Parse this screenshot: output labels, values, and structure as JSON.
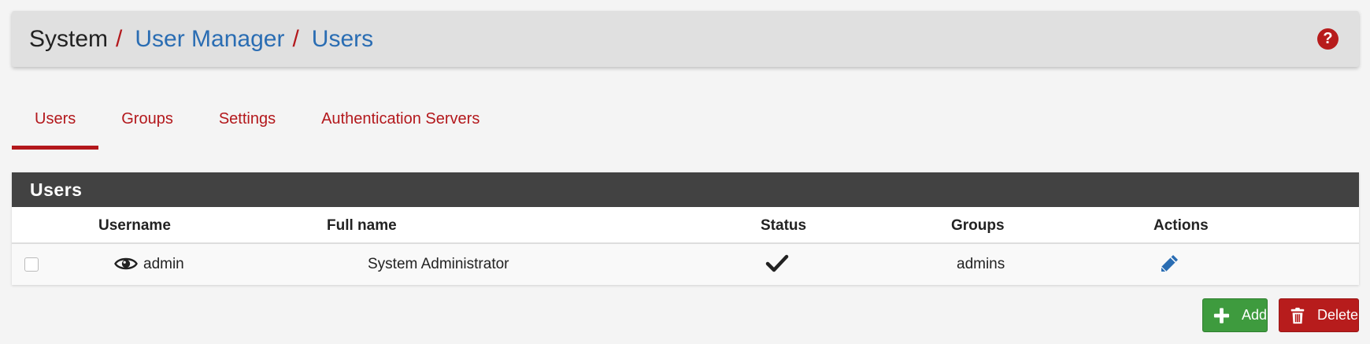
{
  "breadcrumb": {
    "root": "System",
    "separator1": "/",
    "manager": "User Manager",
    "separator2": "/",
    "current": "Users"
  },
  "help": {
    "label": "?"
  },
  "tabs": [
    {
      "label": "Users",
      "active": true
    },
    {
      "label": "Groups",
      "active": false
    },
    {
      "label": "Settings",
      "active": false
    },
    {
      "label": "Authentication Servers",
      "active": false
    }
  ],
  "panel": {
    "title": "Users",
    "columns": [
      "Username",
      "Full name",
      "Status",
      "Groups",
      "Actions"
    ],
    "rows": [
      {
        "checked": false,
        "username": "admin",
        "username_icon": "eye-icon",
        "full_name": "System Administrator",
        "status_icon": "check-icon",
        "groups": "admins",
        "action_icon": "pencil-icon"
      }
    ]
  },
  "buttons": {
    "add": {
      "label": "Add",
      "icon": "plus-icon",
      "color": "#3e9b3e"
    },
    "delete": {
      "label": "Delete",
      "icon": "trash-icon",
      "color": "#b71c1c"
    }
  },
  "colors": {
    "accent_red": "#b3181c",
    "link_blue": "#2a6db3",
    "panel_heading": "#424242"
  }
}
